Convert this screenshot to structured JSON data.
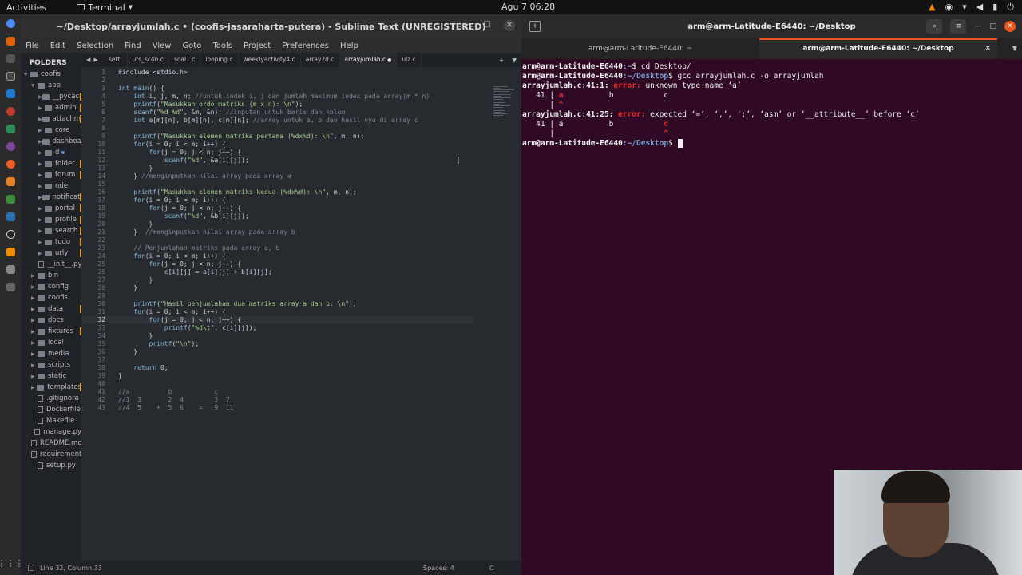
{
  "topbar": {
    "activities": "Activities",
    "app_menu": "Terminal",
    "clock": "Agu 7  06:28"
  },
  "sublime": {
    "title": "~/Desktop/arrayjumlah.c • (coofis-jasaraharta-putera) - Sublime Text (UNREGISTERED)",
    "menu": [
      "File",
      "Edit",
      "Selection",
      "Find",
      "View",
      "Goto",
      "Tools",
      "Project",
      "Preferences",
      "Help"
    ],
    "sidebar_header": "FOLDERS",
    "tree": [
      {
        "label": "coofis",
        "type": "folder",
        "depth": 0,
        "open": true
      },
      {
        "label": "app",
        "type": "folder",
        "depth": 1,
        "open": true
      },
      {
        "label": "__pycache__",
        "type": "folder",
        "depth": 2,
        "mod": true
      },
      {
        "label": "admin",
        "type": "folder",
        "depth": 2,
        "mod": true
      },
      {
        "label": "attachment",
        "type": "folder",
        "depth": 2,
        "mod": true
      },
      {
        "label": "core",
        "type": "folder",
        "depth": 2
      },
      {
        "label": "dashboard",
        "type": "folder",
        "depth": 2
      },
      {
        "label": "d",
        "type": "folder",
        "depth": 2,
        "dot": true
      },
      {
        "label": "folder",
        "type": "folder",
        "depth": 2,
        "mod": true
      },
      {
        "label": "forum",
        "type": "folder",
        "depth": 2,
        "mod": true
      },
      {
        "label": "nde",
        "type": "folder",
        "depth": 2
      },
      {
        "label": "notification",
        "type": "folder",
        "depth": 2,
        "mod": true
      },
      {
        "label": "portal",
        "type": "folder",
        "depth": 2,
        "mod": true
      },
      {
        "label": "profile",
        "type": "folder",
        "depth": 2,
        "mod": true
      },
      {
        "label": "search",
        "type": "folder",
        "depth": 2,
        "mod": true
      },
      {
        "label": "todo",
        "type": "folder",
        "depth": 2,
        "mod": true
      },
      {
        "label": "urly",
        "type": "folder",
        "depth": 2,
        "mod": true
      },
      {
        "label": "__init__.py",
        "type": "file",
        "depth": 2
      },
      {
        "label": "bin",
        "type": "folder",
        "depth": 1
      },
      {
        "label": "config",
        "type": "folder",
        "depth": 1
      },
      {
        "label": "coofis",
        "type": "folder",
        "depth": 1
      },
      {
        "label": "data",
        "type": "folder",
        "depth": 1,
        "mod": true
      },
      {
        "label": "docs",
        "type": "folder",
        "depth": 1
      },
      {
        "label": "fixtures",
        "type": "folder",
        "depth": 1,
        "mod": true
      },
      {
        "label": "local",
        "type": "folder",
        "depth": 1
      },
      {
        "label": "media",
        "type": "folder",
        "depth": 1
      },
      {
        "label": "scripts",
        "type": "folder",
        "depth": 1
      },
      {
        "label": "static",
        "type": "folder",
        "depth": 1
      },
      {
        "label": "templates",
        "type": "folder",
        "depth": 1,
        "mod": true
      },
      {
        "label": ".gitignore",
        "type": "file",
        "depth": 1
      },
      {
        "label": "Dockerfile",
        "type": "file",
        "depth": 1
      },
      {
        "label": "Makefile",
        "type": "file",
        "depth": 1
      },
      {
        "label": "manage.py",
        "type": "file",
        "depth": 1
      },
      {
        "label": "README.md",
        "type": "file",
        "depth": 1
      },
      {
        "label": "requirements.txt",
        "type": "file",
        "depth": 1
      },
      {
        "label": "setup.py",
        "type": "file",
        "depth": 1
      }
    ],
    "tabs": [
      "setti",
      "uts_sc4b.c",
      "soal1.c",
      "looping.c",
      "weeklyactivity4.c",
      "array2d.c",
      "arrayjumlah.c",
      "uiz.c"
    ],
    "active_tab": "arrayjumlah.c",
    "code": [
      "#include <stdio.h>",
      "",
      "int main() {",
      "    int i, j, m, n; //untuk indek i, j dan jumlah maximum index pada array(m * n)",
      "    printf(\"Masukkan ordo matriks (m x n): \\n\");",
      "    scanf(\"%d %d\", &m, &n); //inputan untuk baris dan kolom",
      "    int a[m][n], b[m][n], c[m][n]; //array untuk a, b dan hasil nya di array c",
      "",
      "    printf(\"Masukkan elemen matriks pertama (%dx%d): \\n\", m, n);",
      "    for(i = 0; i < m; i++) {",
      "        for(j = 0; j < n; j++) {",
      "            scanf(\"%d\", &a[i][j]);",
      "        }",
      "    } //menginputkan nilai array pada array a",
      "",
      "    printf(\"Masukkan elemen matriks kedua (%dx%d): \\n\", m, n);",
      "    for(i = 0; i < m; i++) {",
      "        for(j = 0; j < n; j++) {",
      "            scanf(\"%d\", &b[i][j]);",
      "        }",
      "    }  //menginputkan nilai array pada array b",
      "",
      "    // Penjumlahan matriks pada array a, b",
      "    for(i = 0; i < m; i++) {",
      "        for(j = 0; j < n; j++) {",
      "            c[i][j] = a[i][j] + b[i][j];",
      "        }",
      "    }",
      "",
      "    printf(\"Hasil penjumlahan dua matriks array a dan b: \\n\");",
      "    for(i = 0; i < m; i++) {",
      "        for(j = 0; j < n; j++) {",
      "            printf(\"%d\\t\", c[i][j]);",
      "        }",
      "        printf(\"\\n\");",
      "    }",
      "",
      "    return 0;",
      "}",
      "",
      "//a          b           c",
      "//1  3       2  4        3  7",
      "//4  5    +  5  6    =   9  11"
    ],
    "current_line": 32,
    "status": {
      "position": "Line 32, Column 33",
      "spaces": "Spaces: 4",
      "syntax": "C"
    }
  },
  "terminal": {
    "title": "arm@arm-Latitude-E6440: ~/Desktop",
    "tabs": [
      "arm@arm-Latitude-E6440: ~",
      "arm@arm-Latitude-E6440: ~/Desktop"
    ],
    "lines": [
      {
        "kind": "prompt",
        "user": "arm@arm-Latitude-E6440",
        "path": ":~",
        "cmd": "$ cd Desktop/"
      },
      {
        "kind": "prompt",
        "user": "arm@arm-Latitude-E6440",
        "path": ":~/Desktop",
        "cmd": "$ gcc arrayjumlah.c -o arrayjumlah"
      },
      {
        "kind": "error",
        "loc": "arrayjumlah.c:41:1:",
        "label": "error:",
        "msg": " unknown type name ‘a’"
      },
      {
        "kind": "src",
        "gutter": "   41 | ",
        "mark": "a",
        "rest": "          b           c"
      },
      {
        "kind": "src",
        "gutter": "      | ",
        "mark": "^",
        "rest": ""
      },
      {
        "kind": "error",
        "loc": "arrayjumlah.c:41:25:",
        "label": "error:",
        "msg": " expected ‘=’, ‘,’, ‘;’, ‘asm’ or ‘__attribute__’ before ‘c’"
      },
      {
        "kind": "src2",
        "gutter": "   41 | ",
        "pre": "a          b           ",
        "mark": "c"
      },
      {
        "kind": "src2",
        "gutter": "      | ",
        "pre": "                       ",
        "mark": "^"
      },
      {
        "kind": "prompt",
        "user": "arm@arm-Latitude-E6440",
        "path": ":~/Desktop",
        "cmd": "$ ",
        "cursor": true
      }
    ]
  }
}
